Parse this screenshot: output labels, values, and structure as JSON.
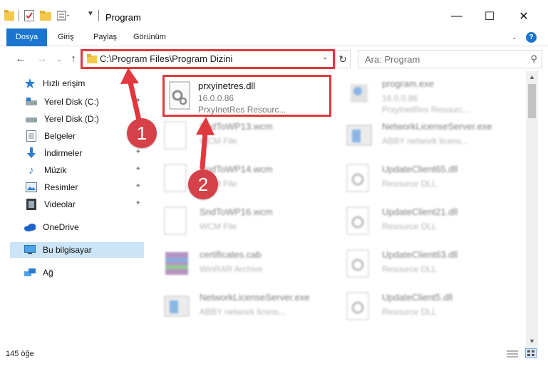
{
  "window": {
    "title": "Program",
    "minimize_label": "—",
    "maximize_label": "☐",
    "close_label": "✕"
  },
  "ribbon": {
    "tabs": [
      "Dosya",
      "Giriş",
      "Paylaş",
      "Görünüm"
    ],
    "help_label": "?"
  },
  "address": {
    "path": "C:\\Program Files\\Program Dizini",
    "search_placeholder": "Ara: Program"
  },
  "sidebar": {
    "items": [
      {
        "label": "Hızlı erişim",
        "icon": "star-icon"
      },
      {
        "label": "Yerel Disk (C:)",
        "icon": "drive-c-icon"
      },
      {
        "label": "Yerel Disk (D:)",
        "icon": "drive-d-icon"
      },
      {
        "label": "Belgeler",
        "icon": "documents-icon"
      },
      {
        "label": "İndirmeler",
        "icon": "downloads-icon"
      },
      {
        "label": "Müzik",
        "icon": "music-icon"
      },
      {
        "label": "Resimler",
        "icon": "pictures-icon"
      },
      {
        "label": "Videolar",
        "icon": "videos-icon"
      },
      {
        "label": "OneDrive",
        "icon": "cloud-icon"
      },
      {
        "label": "Bu bilgisayar",
        "icon": "computer-icon"
      },
      {
        "label": "Ağ",
        "icon": "network-icon"
      }
    ]
  },
  "files": {
    "left": [
      {
        "name": "prxyinetres.dll",
        "line1": "16.0.0.86",
        "line2": "PrxyInetRes Resourc..."
      },
      {
        "name": "SndToWP13.wcm",
        "line1": "WCM File",
        "line2": ""
      },
      {
        "name": "SndToWP14.wcm",
        "line1": "WCM File",
        "line2": ""
      },
      {
        "name": "SndToWP16.wcm",
        "line1": "WCM File",
        "line2": ""
      },
      {
        "name": "certificates.cab",
        "line1": "WinRAR Archive",
        "line2": ""
      },
      {
        "name": "NetworkLicenseServer.exe",
        "line1": "ABBY network licens...",
        "line2": ""
      }
    ],
    "right": [
      {
        "name": "program.exe",
        "line1": "16.0.0.86",
        "line2": "PrxyInetRes Resourc..."
      },
      {
        "name": "NetworkLicenseServer.exe",
        "line1": "ABBY network licens...",
        "line2": ""
      },
      {
        "name": "UpdateClient65.dll",
        "line1": "Resource DLL",
        "line2": ""
      },
      {
        "name": "UpdateClient21.dll",
        "line1": "Resource DLL",
        "line2": ""
      },
      {
        "name": "UpdateClient63.dll",
        "line1": "Resource DLL",
        "line2": ""
      },
      {
        "name": "UpdateClient5.dll",
        "line1": "Resource DLL",
        "line2": ""
      }
    ]
  },
  "status": {
    "count": "145 öğe"
  },
  "annotations": {
    "step1": "1",
    "step2": "2",
    "color": "#e0383e"
  }
}
